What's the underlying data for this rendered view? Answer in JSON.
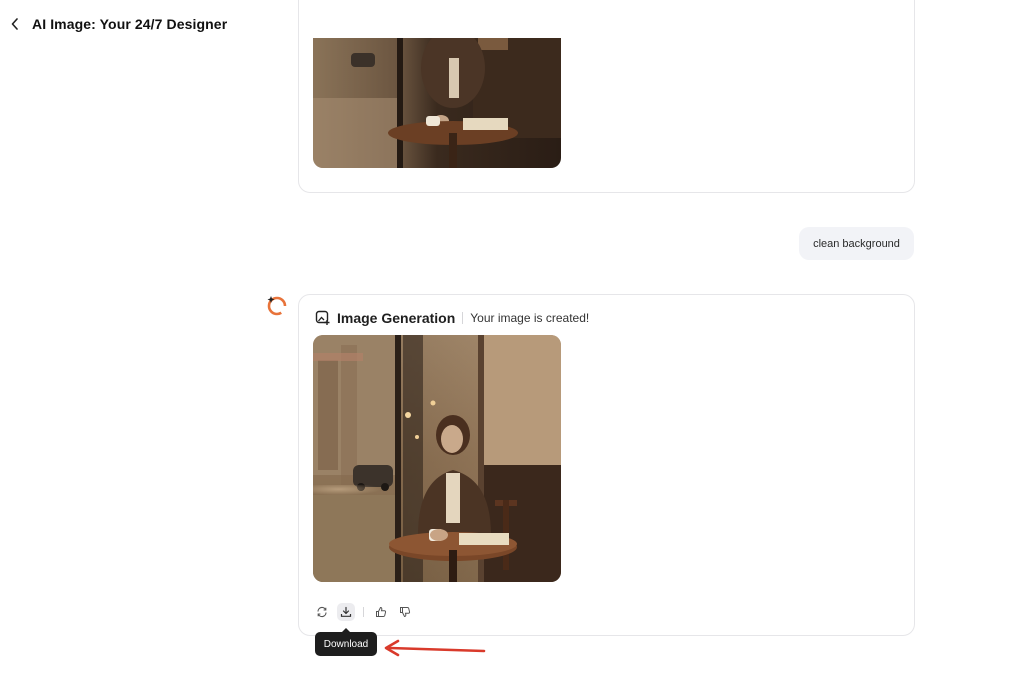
{
  "header": {
    "back_icon": "chevron-left-icon",
    "title": "AI Image: Your 24/7 Designer"
  },
  "conversation": {
    "user_message": "clean background",
    "assistant_card": {
      "tool_icon": "image-generation-icon",
      "tool_name": "Image Generation",
      "status": "Your image is created!"
    },
    "actions": [
      {
        "icon": "regenerate-icon"
      },
      {
        "icon": "download-icon",
        "active": true
      },
      {
        "icon": "thumbs-up-icon"
      },
      {
        "icon": "thumbs-down-icon"
      }
    ],
    "tooltip": "Download"
  },
  "colors": {
    "avatar_accent": "#e8733a",
    "annotation_arrow": "#d93a2b",
    "tooltip_bg": "#1e1e1e",
    "bubble_bg": "#f2f3f7"
  }
}
